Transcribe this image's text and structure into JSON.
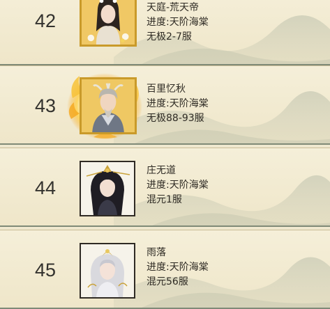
{
  "rows": [
    {
      "rank": "42",
      "name": "天庭-荒天帝",
      "progress": "进度:天阶海棠",
      "server": "无极2-7服",
      "frame": "gold",
      "portrait": "portrait-with-flower-crown"
    },
    {
      "rank": "43",
      "name": "百里忆秋",
      "progress": "进度:天阶海棠",
      "server": "无极88-93服",
      "frame": "gold-flame",
      "portrait": "portrait-elder-with-antler-crown"
    },
    {
      "rank": "44",
      "name": "庄无道",
      "progress": "进度:天阶海棠",
      "server": "混元1服",
      "frame": "plain",
      "portrait": "portrait-long-black-hair"
    },
    {
      "rank": "45",
      "name": "雨落",
      "progress": "进度:天阶海棠",
      "server": "混元56服",
      "frame": "plain",
      "portrait": "portrait-silver-hair-crown"
    }
  ],
  "colors": {
    "row_background": "#f5efd9",
    "row_divider": "#7f8a77",
    "gold_frame": "#c99a2a",
    "flame": "#f6b51e"
  }
}
